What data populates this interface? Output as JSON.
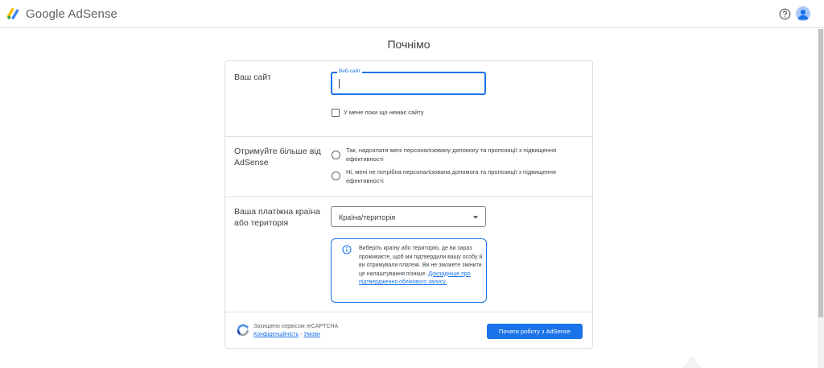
{
  "header": {
    "app_name": "Google AdSense",
    "help_icon": "help-circle-icon",
    "avatar_icon": "account-avatar-icon"
  },
  "page": {
    "title": "Почнімо"
  },
  "site_section": {
    "label": "Ваш сайт",
    "field_label": "Веб-сайт",
    "value": "",
    "no_site_label": "У мене поки що немає сайту"
  },
  "more_section": {
    "label": "Отримуйте більше від AdSense",
    "option_yes": "Так, надсилати мені персоналізовану допомогу та пропозиції з підвищення ефективності",
    "option_no": "Ні, мені не потрібна персоналізована допомога та пропозиції з підвищення ефективності"
  },
  "country_section": {
    "label": "Ваша платіжна країна або територія",
    "select_value": "Країна/територія",
    "info_text": "Виберіть країну або територію, де ви зараз проживаєте, щоб ми підтвердили вашу особу й ви отримували платежі. Ви не зможете змінити це налаштування пізніше. ",
    "info_link": "Докладніше про підтвердження облікового запису."
  },
  "footer": {
    "recaptcha_text": "Захищено сервісом reCAPTCHA",
    "privacy_link": "Конфіденційність",
    "separator": " - ",
    "terms_link": "Умови",
    "start_button": "Почати роботу з AdSense"
  },
  "colors": {
    "accent": "#1a73e8",
    "logo_yellow": "#fbbc04",
    "logo_blue": "#4285f4",
    "logo_green": "#34a853"
  }
}
